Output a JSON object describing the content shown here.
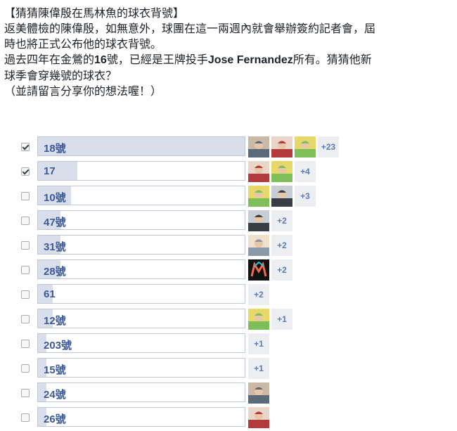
{
  "post": {
    "line1": "【猜猜陳偉殷在馬林魚的球衣背號】",
    "line2": "返美體檢的陳偉殷，如無意外，球團在這一兩週內就會舉辦簽約記者會，屆",
    "line3": "時也將正式公布他的球衣背號。",
    "line4_a": "過去四年在金鶯的",
    "line4_num": "16",
    "line4_b": "號，已經是王牌投手",
    "line4_name": "Jose Fernandez",
    "line4_c": "所有。猜猜他新",
    "line5": "球季會穿幾號的球衣？",
    "line6": "（並請留言分享你的想法喔！）"
  },
  "poll": {
    "options": [
      {
        "label": "18號",
        "checked": true,
        "share": 1.0,
        "faces": [
          "photo-face-icon",
          "photo-face-icon",
          "photo-face-icon"
        ],
        "more": "+23"
      },
      {
        "label": "17",
        "checked": true,
        "share": 0.19,
        "faces": [
          "photo-face-icon",
          "photo-face-icon"
        ],
        "more": "+4"
      },
      {
        "label": "10號",
        "checked": false,
        "share": 0.16,
        "faces": [
          "photo-face-icon",
          "photo-face-icon"
        ],
        "more": "+3"
      },
      {
        "label": "47號",
        "checked": false,
        "share": 0.11,
        "faces": [
          "photo-face-icon"
        ],
        "more": "+2"
      },
      {
        "label": "31號",
        "checked": false,
        "share": 0.11,
        "faces": [
          "photo-face-icon"
        ],
        "more": "+2"
      },
      {
        "label": "28號",
        "checked": false,
        "share": 0.11,
        "faces": [
          "marlins-logo-icon"
        ],
        "more": "+2"
      },
      {
        "label": "61",
        "checked": false,
        "share": 0.07,
        "faces": [],
        "more": "+2"
      },
      {
        "label": "12號",
        "checked": false,
        "share": 0.07,
        "faces": [
          "photo-face-icon"
        ],
        "more": "+1"
      },
      {
        "label": "203號",
        "checked": false,
        "share": 0.04,
        "faces": [],
        "more": "+1"
      },
      {
        "label": "15號",
        "checked": false,
        "share": 0.04,
        "faces": [],
        "more": "+1"
      },
      {
        "label": "24號",
        "checked": false,
        "share": 0.04,
        "faces": [
          "photo-face-icon"
        ],
        "more": ""
      },
      {
        "label": "26號",
        "checked": false,
        "share": 0.04,
        "faces": [
          "photo-face-icon"
        ],
        "more": ""
      }
    ]
  },
  "colors": {
    "bar_fill": "#d8dfea",
    "bar_border": "#bdc7d8",
    "label": "#3b5998",
    "more_badge": "#5b7bb5"
  }
}
